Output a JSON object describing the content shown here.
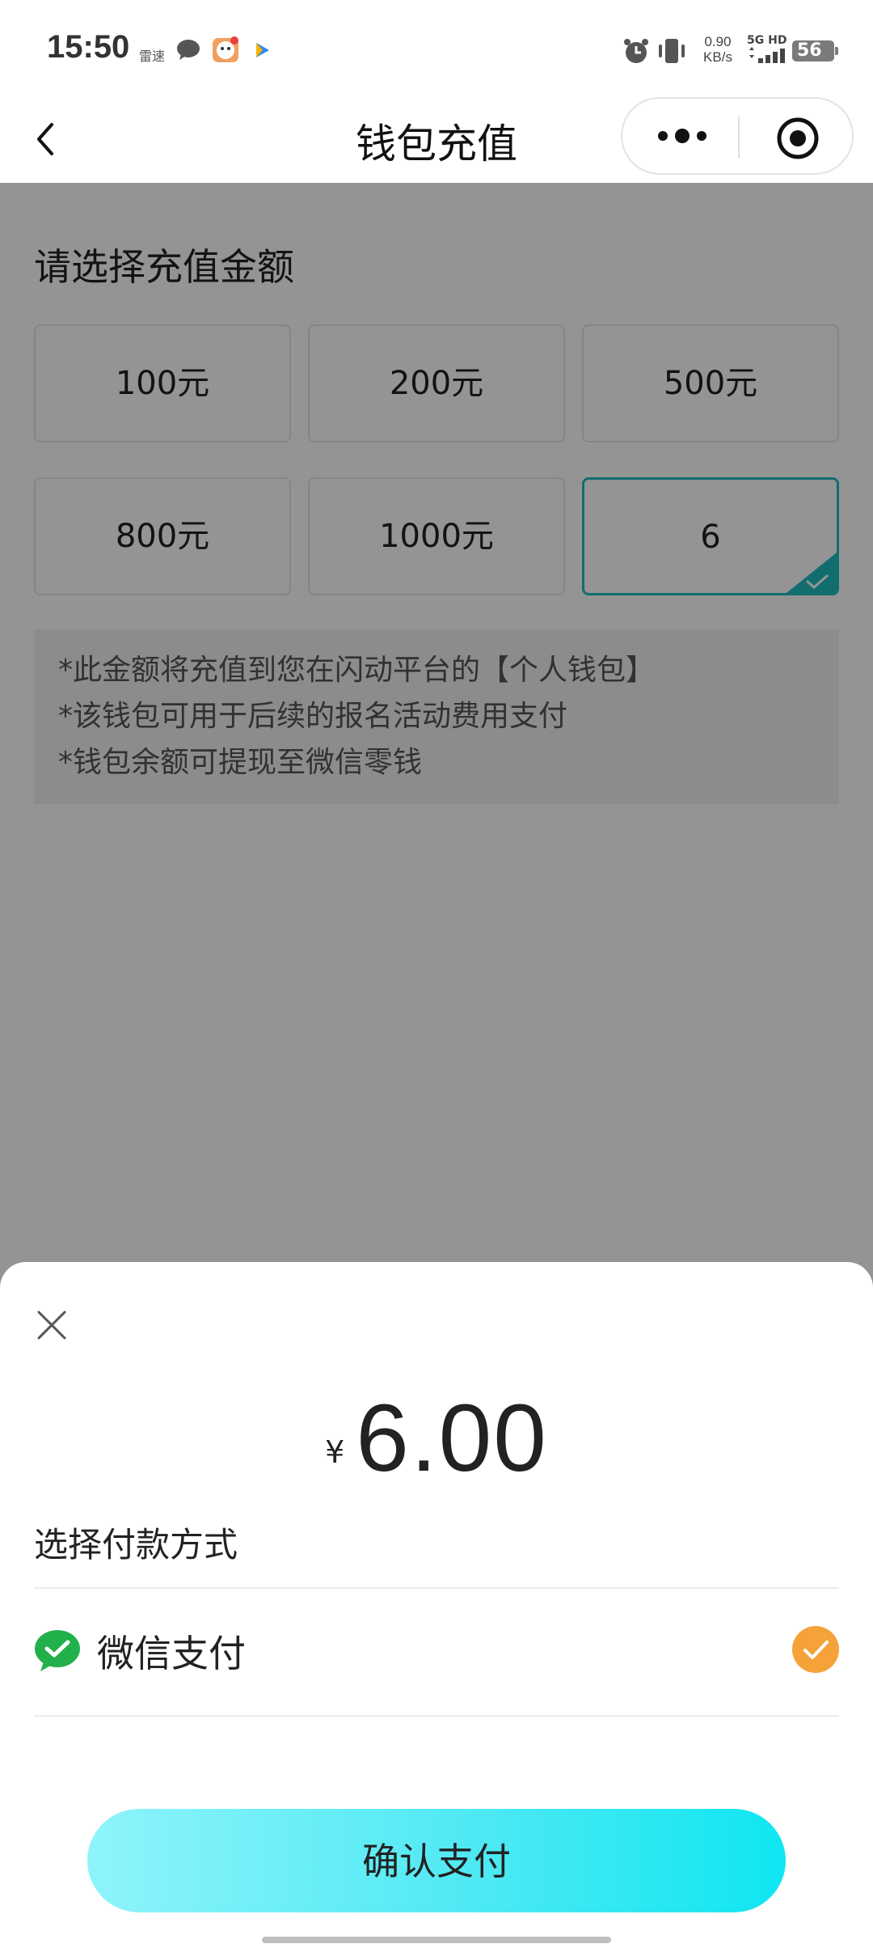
{
  "status_bar": {
    "time": "15:50",
    "app_text": "雷速",
    "net_speed_value": "0.90",
    "net_speed_unit": "KB/s",
    "signal_label": "5G HD",
    "battery": "56"
  },
  "nav": {
    "title": "钱包充值"
  },
  "page": {
    "section_title": "请选择充值金额",
    "amount_options": [
      {
        "label": "100元"
      },
      {
        "label": "200元"
      },
      {
        "label": "500元"
      },
      {
        "label": "800元"
      },
      {
        "label": "1000元"
      },
      {
        "label": "6",
        "selected": true
      }
    ],
    "notes": [
      "*此金额将充值到您在闪动平台的【个人钱包】",
      "*该钱包可用于后续的报名活动费用支付",
      "*钱包余额可提现至微信零钱"
    ]
  },
  "sheet": {
    "currency_symbol": "¥",
    "amount": "6.00",
    "pay_method_title": "选择付款方式",
    "pay_method": {
      "label": "微信支付",
      "icon": "wechat-pay-icon",
      "selected": true
    },
    "confirm_label": "确认支付"
  },
  "colors": {
    "accent_teal": "#1fbcc0",
    "check_orange": "#f5a23a",
    "wechat_green": "#22b04a",
    "button_gradient_start": "#8ff4fb",
    "button_gradient_end": "#0fe6f2"
  }
}
